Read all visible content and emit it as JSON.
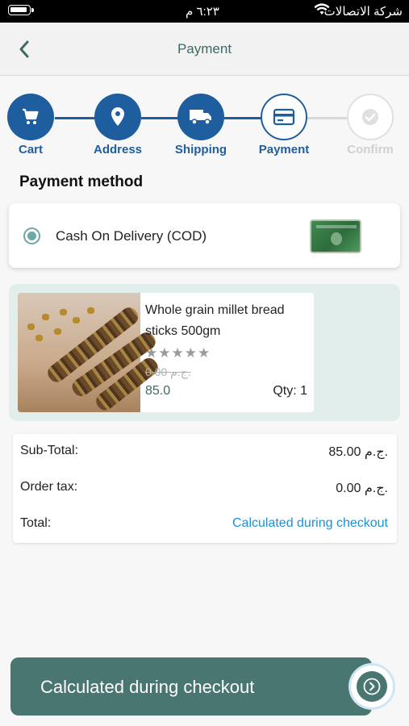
{
  "status_bar": {
    "time": "٦:٢٣ م",
    "carrier": "شركة الاتصالات"
  },
  "header": {
    "title": "Payment",
    "back_icon": "chevron-left-icon"
  },
  "steps": [
    {
      "label": "Cart",
      "icon": "cart-icon",
      "state": "done"
    },
    {
      "label": "Address",
      "icon": "location-pin-icon",
      "state": "done"
    },
    {
      "label": "Shipping",
      "icon": "truck-icon",
      "state": "done"
    },
    {
      "label": "Payment",
      "icon": "credit-card-icon",
      "state": "current"
    },
    {
      "label": "Confirm",
      "icon": "check-circle-icon",
      "state": "disabled"
    }
  ],
  "payment_method": {
    "title": "Payment method",
    "selected_option": "Cash On Delivery (COD)"
  },
  "product": {
    "name": "Whole grain millet bread sticks 500gm",
    "rating_stars": "★★★★★",
    "old_price": "0.00 ج.م.",
    "price": "85.0",
    "qty": "Qty: 1"
  },
  "totals": {
    "subtotal_label": "Sub-Total:",
    "subtotal_value": "85.00 ج.م.",
    "tax_label": "Order tax:",
    "tax_value": "0.00 ج.م.",
    "total_label": "Total:",
    "total_value": "Calculated during checkout"
  },
  "checkout_button": {
    "label": "Calculated during checkout"
  },
  "colors": {
    "primary_blue": "#1f5e9e",
    "teal": "#4a7671",
    "link_blue": "#1e90d6",
    "disabled_grey": "#d0d0d0"
  }
}
